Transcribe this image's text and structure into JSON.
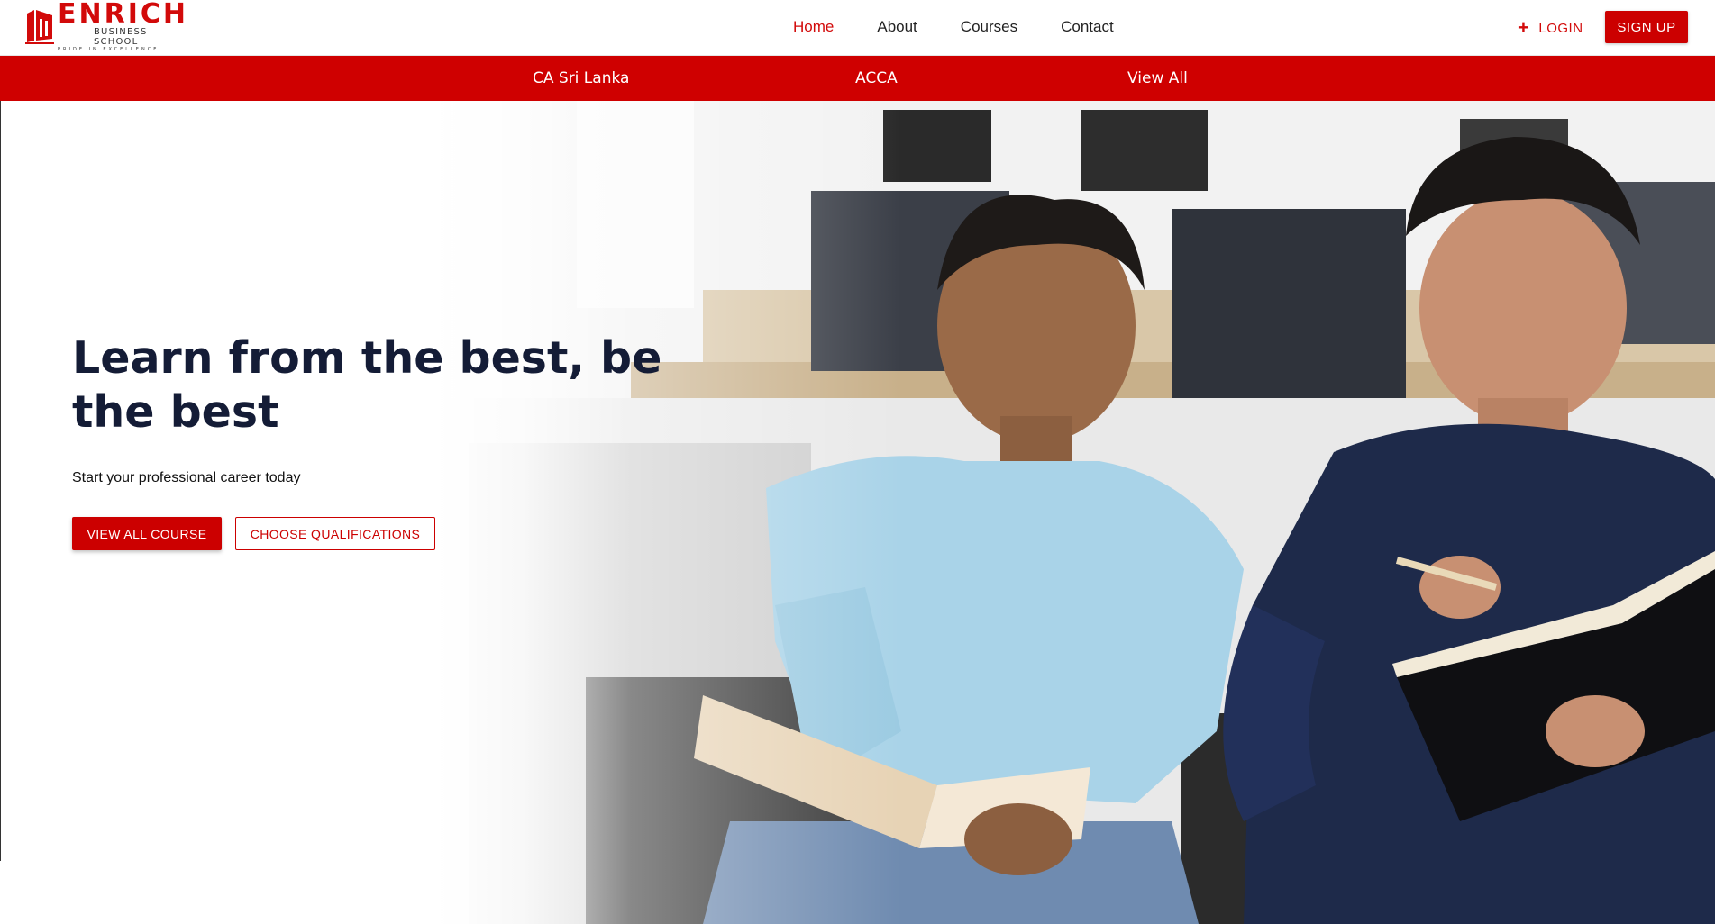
{
  "brand": {
    "name": "ENRICH",
    "subtitle": "BUSINESS SCHOOL",
    "tagline": "PRIDE IN EXCELLENCE",
    "accent_color": "#cc0000"
  },
  "nav": {
    "items": [
      {
        "label": "Home",
        "active": true
      },
      {
        "label": "About",
        "active": false
      },
      {
        "label": "Courses",
        "active": false
      },
      {
        "label": "Contact",
        "active": false
      }
    ],
    "login_label": "LOGIN",
    "login_icon": "plus-icon",
    "signup_label": "SIGN UP"
  },
  "subnav": {
    "items": [
      {
        "label": "CA Sri Lanka"
      },
      {
        "label": "ACCA"
      },
      {
        "label": "View All"
      }
    ]
  },
  "hero": {
    "title": "Learn from the best, be the best",
    "subtitle": "Start your professional career today",
    "primary_button": "VIEW ALL COURSE",
    "secondary_button": "CHOOSE QUALIFICATIONS"
  }
}
